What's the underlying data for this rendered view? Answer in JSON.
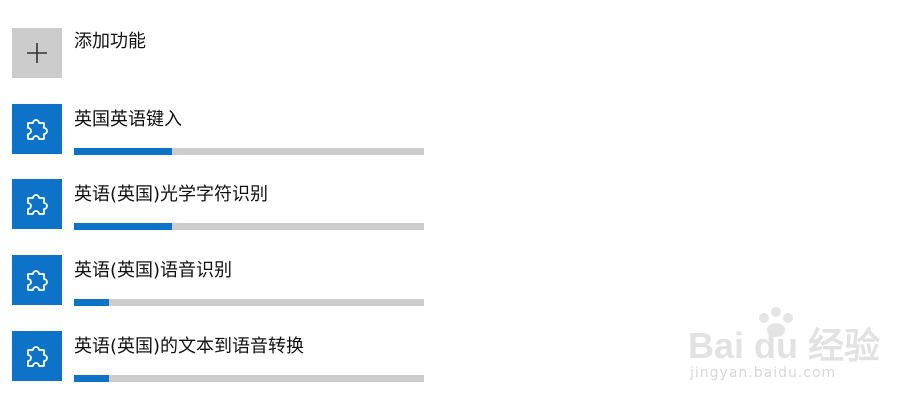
{
  "add_feature": {
    "label": "添加功能",
    "icon": "plus-icon"
  },
  "features": [
    {
      "name": "英国英语键入",
      "icon": "puzzle-piece-icon",
      "progress": 0.28
    },
    {
      "name": "英语(英国)光学字符识别",
      "icon": "puzzle-piece-icon",
      "progress": 0.28
    },
    {
      "name": "英语(英国)语音识别",
      "icon": "puzzle-piece-icon",
      "progress": 0.1
    },
    {
      "name": "英语(英国)的文本到语音转换",
      "icon": "puzzle-piece-icon",
      "progress": 0.1
    }
  ],
  "watermark": {
    "logo_text": "Bai du 经验",
    "url": "jingyan.baidu.com"
  },
  "colors": {
    "accent": "#0c73c9",
    "track": "#cccccc",
    "add_tile": "#cccccc"
  }
}
